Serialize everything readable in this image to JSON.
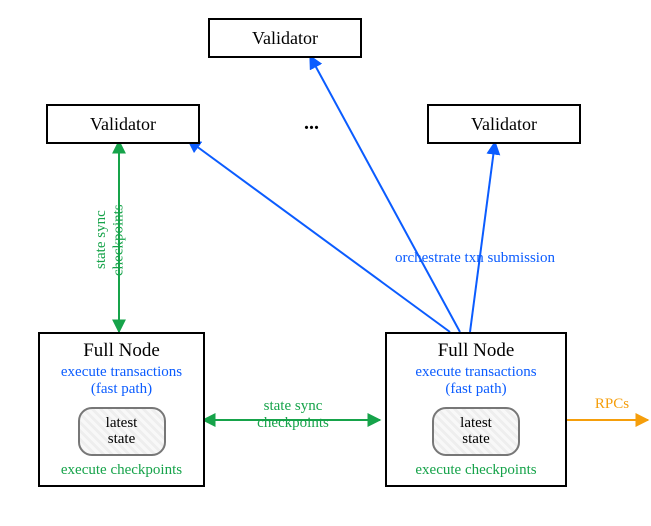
{
  "validators": {
    "top": "Validator",
    "left": "Validator",
    "right": "Validator",
    "ellipsis": "..."
  },
  "full_nodes": {
    "left": {
      "title": "Full Node",
      "exec_line1": "execute transactions",
      "exec_line2": "(fast path)",
      "state_line1": "latest",
      "state_line2": "state",
      "checkpoints": "execute checkpoints"
    },
    "right": {
      "title": "Full Node",
      "exec_line1": "execute transactions",
      "exec_line2": "(fast path)",
      "state_line1": "latest",
      "state_line2": "state",
      "checkpoints": "execute checkpoints"
    }
  },
  "labels": {
    "state_sync_left_line1": "state sync",
    "state_sync_left_line2": "checkpoints",
    "state_sync_mid_line1": "state sync",
    "state_sync_mid_line2": "checkpoints",
    "orchestrate": "orchestrate txn submission",
    "rpcs": "RPCs"
  },
  "colors": {
    "blue": "#0b5cff",
    "green": "#16a34a",
    "orange": "#f59e0b"
  }
}
